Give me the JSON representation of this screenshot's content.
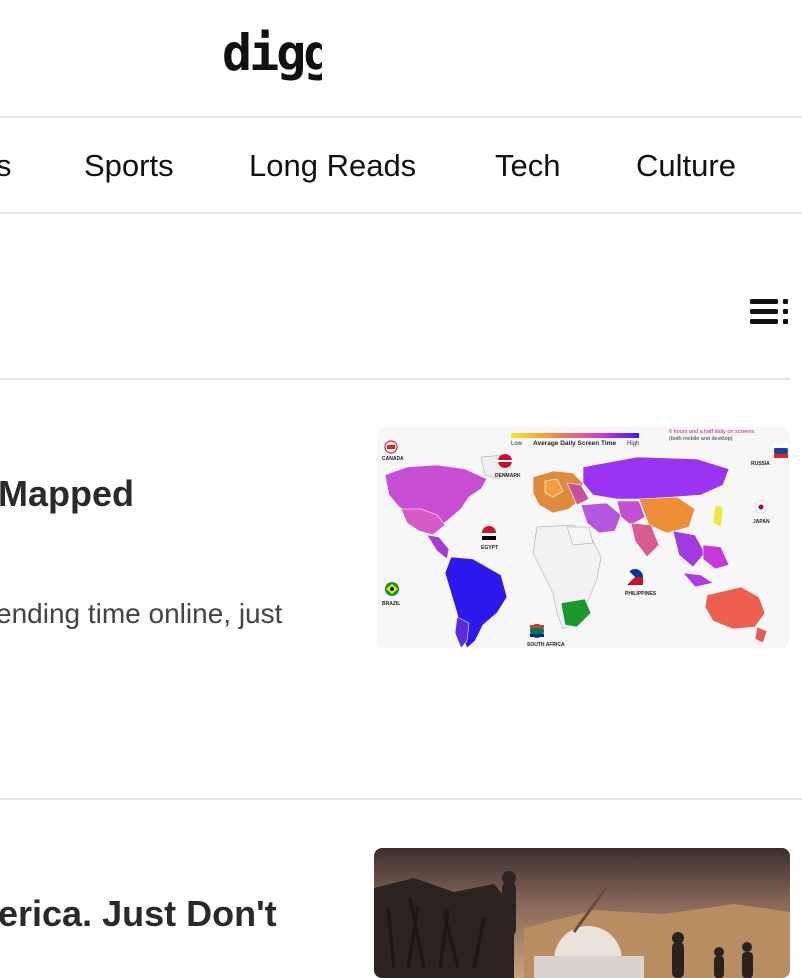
{
  "site": {
    "logo_text": "digg"
  },
  "nav": {
    "items": [
      {
        "label": "s"
      },
      {
        "label": "Sports"
      },
      {
        "label": "Long Reads"
      },
      {
        "label": "Tech"
      },
      {
        "label": "Culture"
      }
    ]
  },
  "toolbar": {
    "menu_icon": "list-menu-icon"
  },
  "stories": [
    {
      "title": "Mapped",
      "description": "ending time online, just",
      "thumbnail": {
        "kind": "world-map",
        "header_label": "Average Daily Screen Time",
        "legend_low": "Low",
        "legend_high": "High",
        "callout": "6 hours and a half daily on screens (both mobile and desktop)",
        "countries": [
          "CANADA",
          "DENMARK",
          "RUSSIA",
          "JAPAN",
          "EGYPT",
          "BRAZIL",
          "PHILIPPINES",
          "SOUTH AFRICA"
        ]
      }
    },
    {
      "title": "erica. Just Don't",
      "thumbnail": {
        "kind": "illustration"
      }
    }
  ]
}
